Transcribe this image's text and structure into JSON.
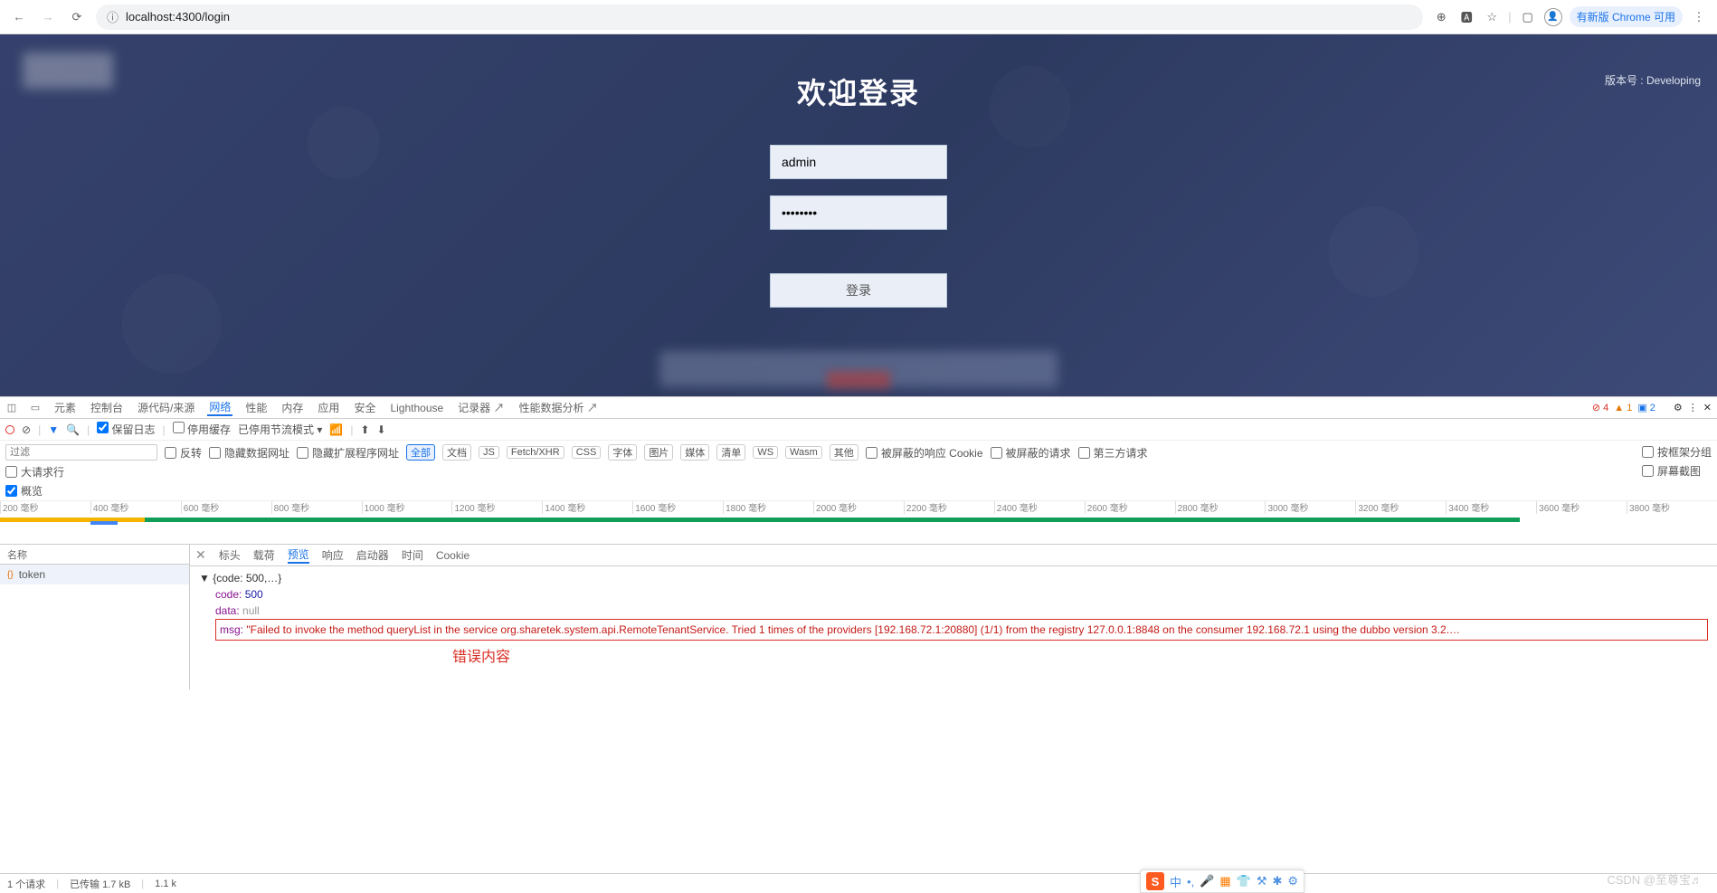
{
  "browser": {
    "url": "localhost:4300/login",
    "badge": "有新版 Chrome 可用"
  },
  "login": {
    "version": "版本号 : Developing",
    "title": "欢迎登录",
    "username": "admin",
    "password": "••••••••",
    "button": "登录"
  },
  "devtools": {
    "tabs": {
      "elements": "元素",
      "console": "控制台",
      "sources": "源代码/来源",
      "network": "网络",
      "performance": "性能",
      "memory": "内存",
      "application": "应用",
      "security": "安全",
      "lighthouse": "Lighthouse",
      "recorder": "记录器",
      "perf_insights": "性能数据分析"
    },
    "issues": {
      "errors": "4",
      "warnings": "1",
      "info": "2"
    },
    "net_toolbar": {
      "preserve_log": "保留日志",
      "disable_cache": "停用缓存",
      "throttle": "已停用节流模式"
    },
    "filter_placeholder": "过滤",
    "filters": {
      "invert": "反转",
      "hide_data": "隐藏数据网址",
      "hide_ext": "隐藏扩展程序网址",
      "all": "全部",
      "doc": "文档",
      "js": "JS",
      "fetch": "Fetch/XHR",
      "css": "CSS",
      "font": "字体",
      "img": "图片",
      "media": "媒体",
      "manifest": "清单",
      "ws": "WS",
      "wasm": "Wasm",
      "other": "其他",
      "blocked_cookies": "被屏蔽的响应 Cookie",
      "blocked_req": "被屏蔽的请求",
      "third": "第三方请求"
    },
    "options": {
      "large_rows": "大请求行",
      "group_frame": "按框架分组",
      "overview": "概览",
      "screenshot": "屏幕截图"
    },
    "timeline": [
      "200 毫秒",
      "400 毫秒",
      "600 毫秒",
      "800 毫秒",
      "1000 毫秒",
      "1200 毫秒",
      "1400 毫秒",
      "1600 毫秒",
      "1800 毫秒",
      "2000 毫秒",
      "2200 毫秒",
      "2400 毫秒",
      "2600 毫秒",
      "2800 毫秒",
      "3000 毫秒",
      "3200 毫秒",
      "3400 毫秒",
      "3600 毫秒",
      "3800 毫秒"
    ],
    "name_col": "名称",
    "request": "token",
    "detail_tabs": {
      "headers": "标头",
      "payload": "载荷",
      "preview": "预览",
      "response": "响应",
      "initiator": "启动器",
      "timing": "时间",
      "cookies": "Cookie"
    },
    "json": {
      "root": "{code: 500,…}",
      "code_k": "code:",
      "code_v": "500",
      "data_k": "data:",
      "data_v": "null",
      "msg_k": "msg:",
      "msg_v": "\"Failed to invoke the method queryList in the service org.sharetek.system.api.RemoteTenantService. Tried 1 times of the providers [192.168.72.1:20880] (1/1) from the registry 127.0.0.1:8848 on the consumer 192.168.72.1 using the dubbo version 3.2.…"
    },
    "annotation": "错误内容",
    "status": {
      "requests": "1 个请求",
      "transferred": "已传输 1.7 kB",
      "resources": "1.1 k"
    }
  },
  "ime": {
    "mode": "中"
  },
  "watermark": "CSDN @至尊宝♬"
}
